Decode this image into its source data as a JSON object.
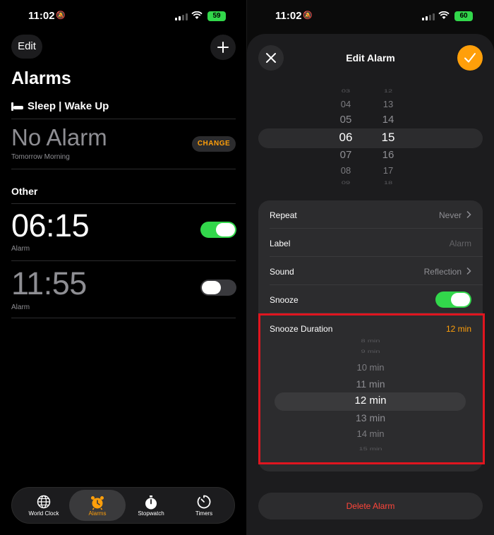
{
  "left": {
    "status": {
      "time": "11:02",
      "battery": "59"
    },
    "edit_label": "Edit",
    "title": "Alarms",
    "sleep_label": "Sleep | Wake Up",
    "no_alarm": "No Alarm",
    "no_alarm_sub": "Tomorrow Morning",
    "change_label": "CHANGE",
    "other_label": "Other",
    "alarms": [
      {
        "time": "06:15",
        "label": "Alarm",
        "enabled": true
      },
      {
        "time": "11:55",
        "label": "Alarm",
        "enabled": false
      }
    ],
    "tabs": [
      {
        "label": "World Clock",
        "icon": "globe-icon"
      },
      {
        "label": "Alarms",
        "icon": "alarm-clock-icon",
        "active": true
      },
      {
        "label": "Stopwatch",
        "icon": "stopwatch-icon"
      },
      {
        "label": "Timers",
        "icon": "timer-icon"
      }
    ]
  },
  "right": {
    "status": {
      "time": "11:02",
      "battery": "60"
    },
    "title": "Edit Alarm",
    "picker": {
      "hours": [
        "03",
        "04",
        "05",
        "06",
        "07",
        "08",
        "09"
      ],
      "minutes": [
        "12",
        "13",
        "14",
        "15",
        "16",
        "17",
        "18"
      ],
      "selected_hour": "06",
      "selected_minute": "15"
    },
    "settings": {
      "repeat": {
        "label": "Repeat",
        "value": "Never"
      },
      "label": {
        "label": "Label",
        "value": "Alarm"
      },
      "sound": {
        "label": "Sound",
        "value": "Reflection"
      },
      "snooze": {
        "label": "Snooze",
        "enabled": true
      },
      "snooze_duration": {
        "label": "Snooze Duration",
        "value": "12 min"
      }
    },
    "snooze_options": [
      "8 min",
      "9 min",
      "10 min",
      "11 min",
      "12 min",
      "13 min",
      "14 min",
      "15 min"
    ],
    "delete_label": "Delete Alarm"
  },
  "colors": {
    "accent_orange": "#ff9f0a",
    "toggle_green": "#32d74b",
    "delete_red": "#ff453a",
    "highlight_red": "#e0151f"
  }
}
